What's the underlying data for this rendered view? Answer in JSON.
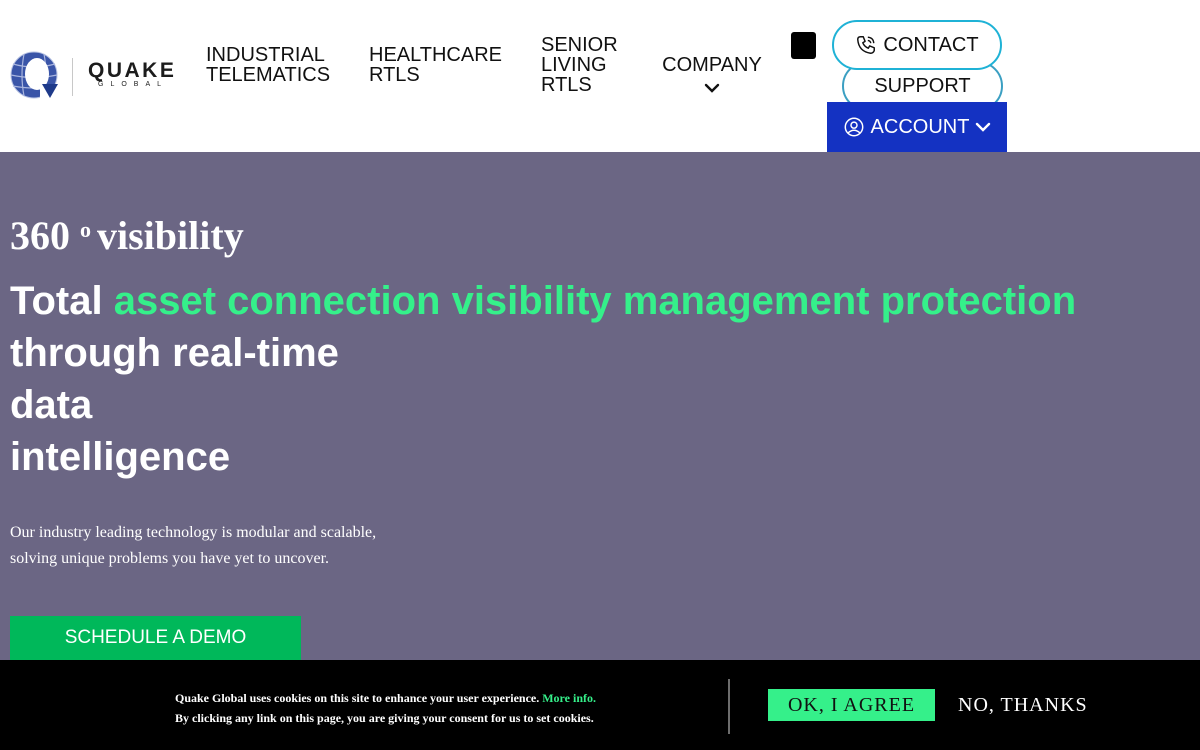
{
  "brand": {
    "name": "QUAKE",
    "subname": "GLOBAL",
    "icon": "quake-global-logo-mark"
  },
  "nav": {
    "items": [
      {
        "line1": "INDUSTRIAL",
        "line2": "TELEMATICS"
      },
      {
        "line1": "HEALTHCARE",
        "line2": "RTLS"
      },
      {
        "line1": "SENIOR",
        "line2": "LIVING",
        "line3": "RTLS"
      },
      {
        "line1": "COMPANY"
      }
    ],
    "contact_label": "CONTACT",
    "support_label": "SUPPORT",
    "account_label": "ACCOUNT"
  },
  "hero": {
    "eyebrow_number": "360",
    "eyebrow_degree": "o",
    "eyebrow_word": "visibility",
    "headline_prefix": "Total",
    "headline_accent": "asset connection visibility management protection",
    "headline_line2": "through real-time",
    "headline_line3": "data",
    "headline_line4": "intelligence",
    "description_line1": "Our industry leading technology is modular and scalable,",
    "description_line2": "solving unique problems you have yet to uncover.",
    "cta_label": "SCHEDULE A DEMO"
  },
  "cookie": {
    "line1": "Quake Global uses cookies on this site to enhance your user experience.",
    "more_info": "More info.",
    "line2": "By clicking any link on this page, you are giving your consent for us to set cookies.",
    "agree_label": "OK, I AGREE",
    "decline_label": "NO, THANKS"
  },
  "colors": {
    "hero_bg": "#6b6684",
    "accent_green": "#35f08a",
    "cta_green": "#00b85a",
    "account_blue": "#1432c2",
    "contact_border": "#1fb2d6"
  }
}
